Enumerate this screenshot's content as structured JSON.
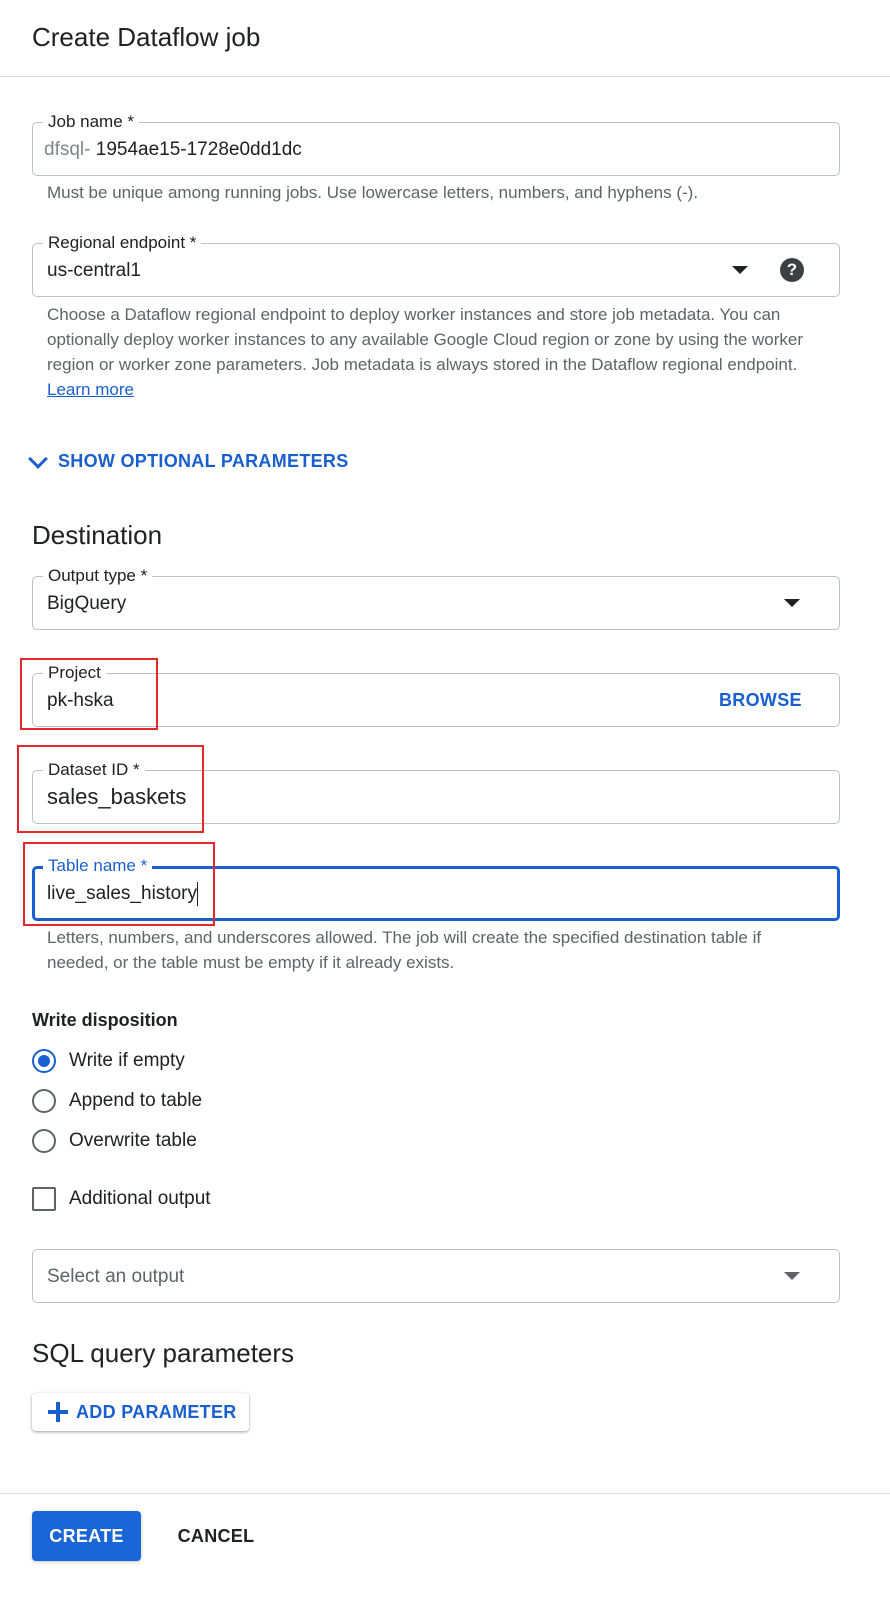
{
  "header": {
    "title": "Create Dataflow job"
  },
  "job_name": {
    "label": "Job name *",
    "prefix": "dfsql-",
    "value": "1954ae15-1728e0dd1dc",
    "hint": "Must be unique among running jobs. Use lowercase letters, numbers, and hyphens (-)."
  },
  "regional_endpoint": {
    "label": "Regional endpoint *",
    "value": "us-central1",
    "help_icon": "?",
    "hint": "Choose a Dataflow regional endpoint to deploy worker instances and store job metadata. You can optionally deploy worker instances to any available Google Cloud region or zone by using the worker region or worker zone parameters. Job metadata is always stored in the Dataflow regional endpoint.",
    "learn_more": "Learn more"
  },
  "optional_params": {
    "label": "SHOW OPTIONAL PARAMETERS"
  },
  "destination": {
    "title": "Destination",
    "output_type": {
      "label": "Output type *",
      "value": "BigQuery"
    },
    "project": {
      "label": "Project",
      "value": "pk-hska",
      "browse": "BROWSE"
    },
    "dataset_id": {
      "label": "Dataset ID *",
      "value": "sales_baskets"
    },
    "table_name": {
      "label": "Table name *",
      "value": "live_sales_history",
      "hint": "Letters, numbers, and underscores allowed. The job will create the specified destination table if needed, or the table must be empty if it already exists."
    }
  },
  "write_disposition": {
    "title": "Write disposition",
    "options": [
      "Write if empty",
      "Append to table",
      "Overwrite table"
    ],
    "selected": "Write if empty"
  },
  "additional_output": {
    "label": "Additional output",
    "checked": false
  },
  "select_output": {
    "placeholder": "Select an output"
  },
  "sql_params": {
    "title": "SQL query parameters",
    "add_button": "ADD PARAMETER"
  },
  "footer": {
    "create": "CREATE",
    "cancel": "CANCEL"
  },
  "colors": {
    "accent": "#1a5fd0",
    "highlight_box": "#e8272c"
  }
}
